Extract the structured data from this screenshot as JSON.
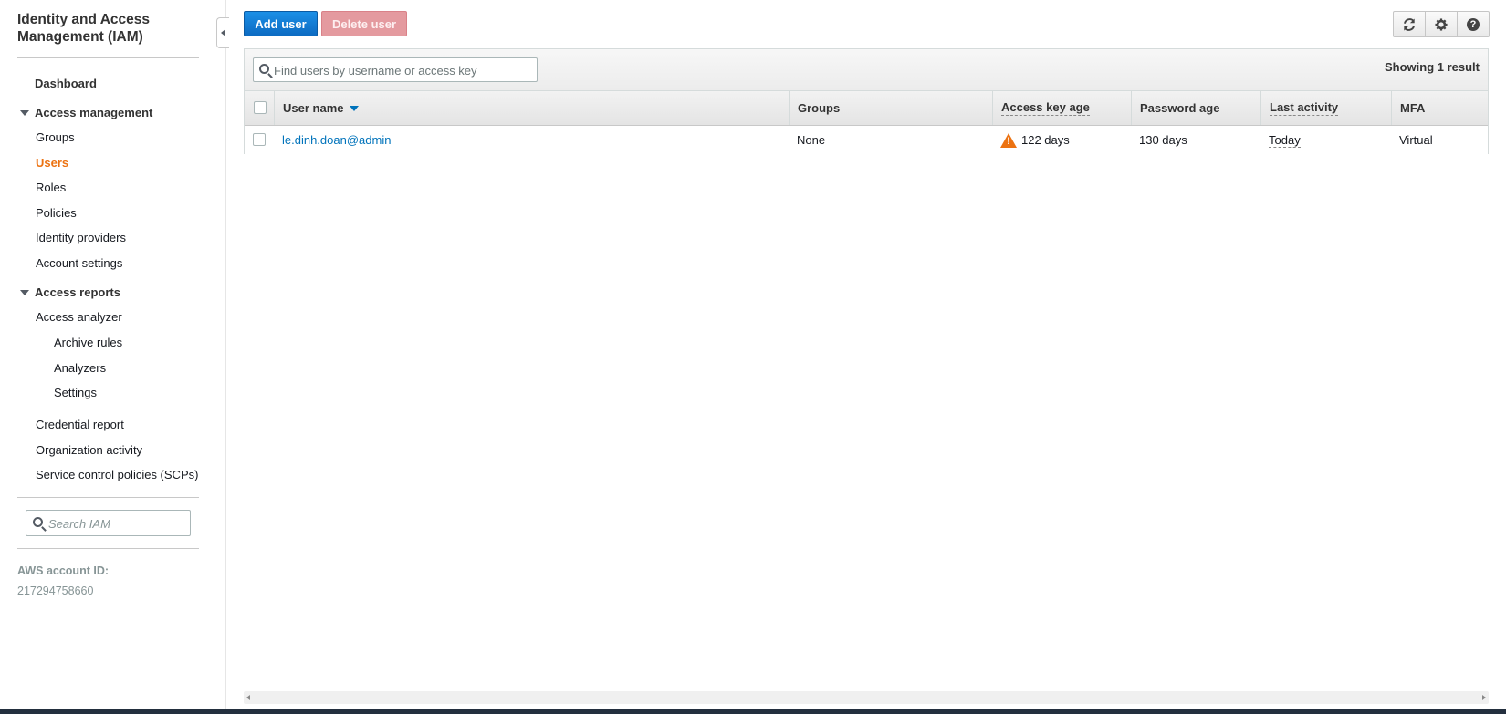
{
  "sidebar": {
    "title": "Identity and Access Management (IAM)",
    "dashboard": "Dashboard",
    "access_management": {
      "label": "Access management",
      "items": [
        "Groups",
        "Users",
        "Roles",
        "Policies",
        "Identity providers",
        "Account settings"
      ],
      "active": "Users"
    },
    "access_reports": {
      "label": "Access reports",
      "analyzer": "Access analyzer",
      "analyzer_items": [
        "Archive rules",
        "Analyzers",
        "Settings"
      ],
      "items": [
        "Credential report",
        "Organization activity",
        "Service control policies (SCPs)"
      ]
    },
    "search": {
      "placeholder": "Search IAM"
    },
    "account": {
      "label": "AWS account ID:",
      "id": "217294758660"
    }
  },
  "toolbar": {
    "add_user": "Add user",
    "delete_user": "Delete user",
    "icons": [
      "refresh-icon",
      "gear-icon",
      "help-icon"
    ]
  },
  "table": {
    "filter_placeholder": "Find users by username or access key",
    "result_count": "Showing 1 result",
    "columns": [
      "User name",
      "Groups",
      "Access key age",
      "Password age",
      "Last activity",
      "MFA"
    ],
    "rows": [
      {
        "user_name": "le.dinh.doan@admin",
        "groups": "None",
        "access_key_age": "122 days",
        "password_age": "130 days",
        "last_activity": "Today",
        "mfa": "Virtual"
      }
    ]
  },
  "colors": {
    "primary": "#0d6bc2",
    "danger_disabled": "#e49a9f",
    "active_nav": "#ec7211",
    "link": "#0073bb",
    "warning": "#ec7211"
  }
}
